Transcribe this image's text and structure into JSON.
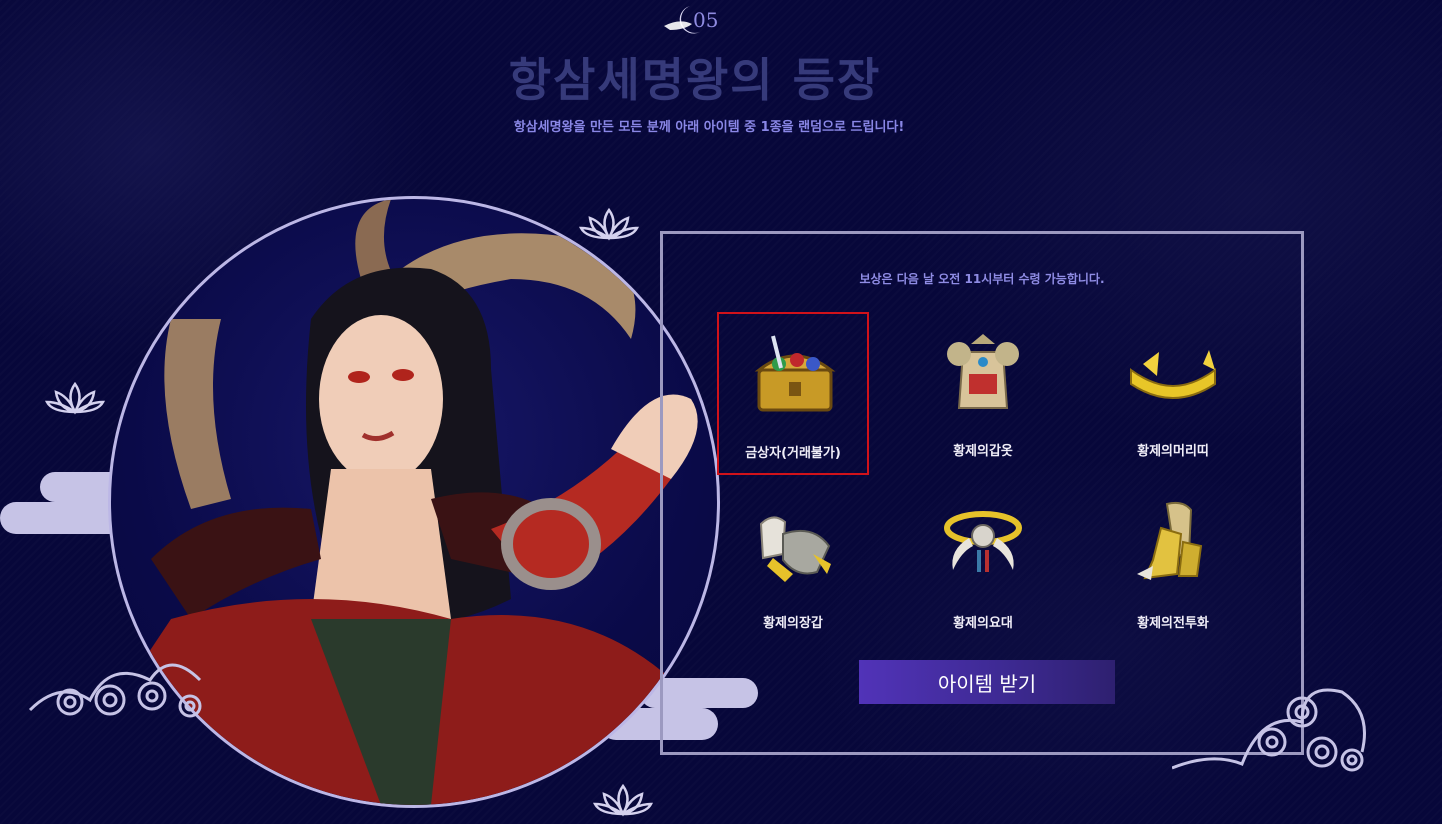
{
  "header": {
    "section_number": "05",
    "title": "항삼세명왕의 등장",
    "subtitle": "항삼세명왕을 만든 모든 분께 아래 아이템 중 1종을 랜덤으로 드립니다!"
  },
  "rewards": {
    "notice": "보상은 다음 날  오전 11시부터 수령 가능합니다.",
    "items": [
      {
        "label": "금상자(거래불가)",
        "icon": "treasure-chest-icon",
        "selected": true
      },
      {
        "label": "황제의갑옷",
        "icon": "armor-icon"
      },
      {
        "label": "황제의머리띠",
        "icon": "headband-icon"
      },
      {
        "label": "황제의장갑",
        "icon": "gauntlet-icon"
      },
      {
        "label": "황제의요대",
        "icon": "belt-icon"
      },
      {
        "label": "황제의전투화",
        "icon": "boots-icon"
      }
    ],
    "button_label": "아이템 받기"
  },
  "colors": {
    "background": "#07073a",
    "accent": "#8f8ce4",
    "button": "#4a30a8",
    "selection": "#d0121a",
    "frame": "#9c99c0"
  }
}
